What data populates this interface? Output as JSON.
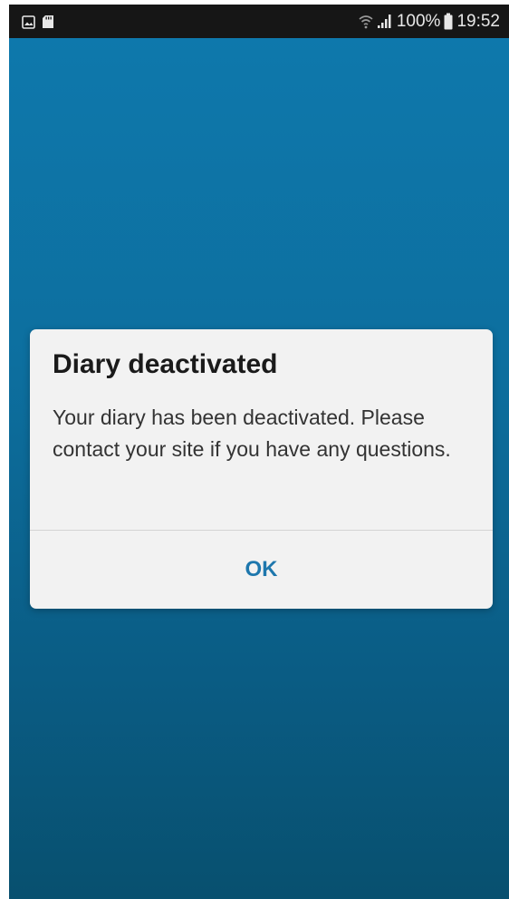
{
  "status_bar": {
    "left_icons": [
      "picture-icon",
      "sd-card-icon"
    ],
    "right_icons": [
      "wifi-icon",
      "signal-icon",
      "battery-icon"
    ],
    "battery_percent": "100%",
    "time": "19:52"
  },
  "dialog": {
    "title": "Diary deactivated",
    "message": "Your diary has been deactivated. Please contact your site if you have any questions.",
    "ok_label": "OK"
  },
  "colors": {
    "background_top": "#0e79ad",
    "background_bottom": "#08506f",
    "dialog_bg": "#f2f2f2",
    "accent": "#1e77ad",
    "status_bar_bg": "#161616"
  }
}
